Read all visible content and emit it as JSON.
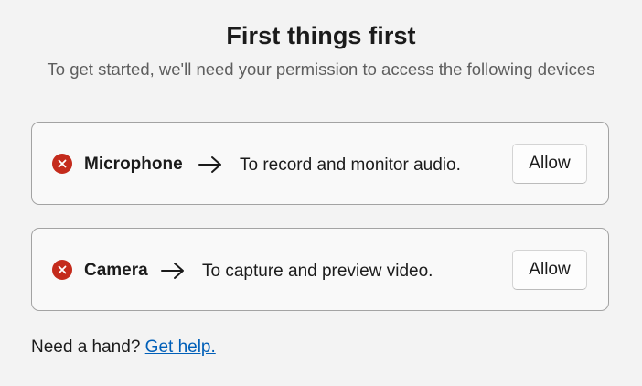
{
  "header": {
    "title": "First things first",
    "subtitle": "To get started, we'll need your permission to access the following devices"
  },
  "devices": [
    {
      "name": "Microphone",
      "status_icon": "error-circle-icon",
      "arrow_icon": "arrow-right-icon",
      "description": "To record and monitor audio.",
      "button_label": "Allow"
    },
    {
      "name": "Camera",
      "status_icon": "error-circle-icon",
      "arrow_icon": "arrow-right-icon",
      "description": "To capture and preview video.",
      "button_label": "Allow"
    }
  ],
  "footer": {
    "help_prompt": "Need a hand?",
    "help_link": "Get help."
  },
  "colors": {
    "background": "#f3f3f3",
    "error_red": "#c42b1c",
    "link_blue": "#005fb8",
    "card_border": "#a3a3a3"
  }
}
